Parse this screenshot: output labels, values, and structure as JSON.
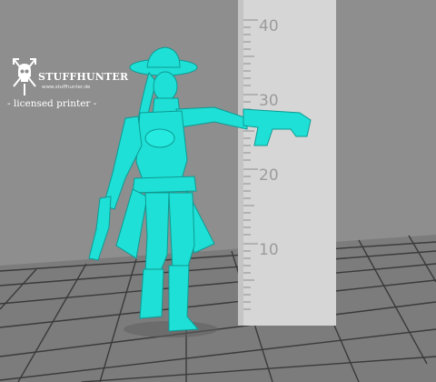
{
  "scene": {
    "subject": "cowgirl gunslinger miniature with wide-brim hat holding pistols",
    "subject_color": "#1ee0d6",
    "background_color": "#8c8c8c",
    "floor_color": "#7a7a7a",
    "grid_line_color": "#3a3a3a"
  },
  "ruler": {
    "labels": [
      "40",
      "30",
      "20",
      "10"
    ],
    "color": "#d9d9d9"
  },
  "logo": {
    "brand": "STUFFHUNTER",
    "url": "www.stuffhunter.de",
    "tagline": "- licensed printer -",
    "icon": "skull-crossed-arrows-icon"
  }
}
